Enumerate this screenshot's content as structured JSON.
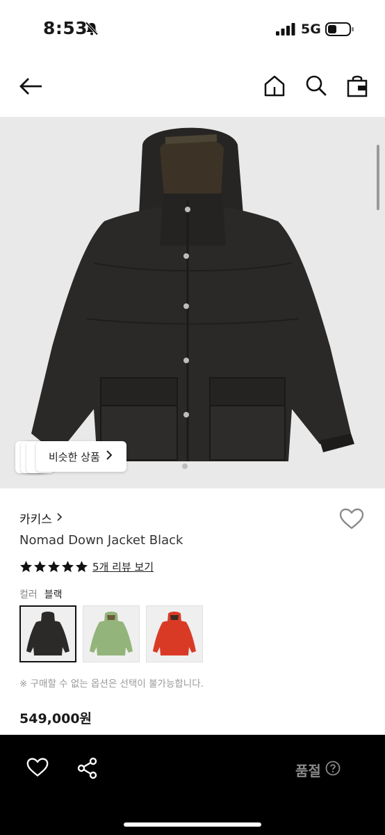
{
  "status_bar": {
    "time": "8:53",
    "network": "5G"
  },
  "product": {
    "similar_button_label": "비슷한 상품",
    "brand": "카키스",
    "name": "Nomad Down Jacket Black",
    "rating_stars": 5,
    "review_link": "5개 리뷰 보기",
    "color_label": "컬러",
    "color_value": "블랙",
    "swatches": [
      {
        "name": "black",
        "color": "#2b2a28"
      },
      {
        "name": "green",
        "color": "#93b47a"
      },
      {
        "name": "red",
        "color": "#d93a26"
      }
    ],
    "option_note": "※ 구매할 수 없는 옵션은 선택이 불가능합니다.",
    "price": "549,000원"
  },
  "bottom_bar": {
    "status_label": "품절"
  },
  "colors": {
    "image_bg": "#e9e9e9",
    "jacket": "#2b2a28",
    "bar_bg": "#000000",
    "soldout_text": "#8a8a8a"
  }
}
